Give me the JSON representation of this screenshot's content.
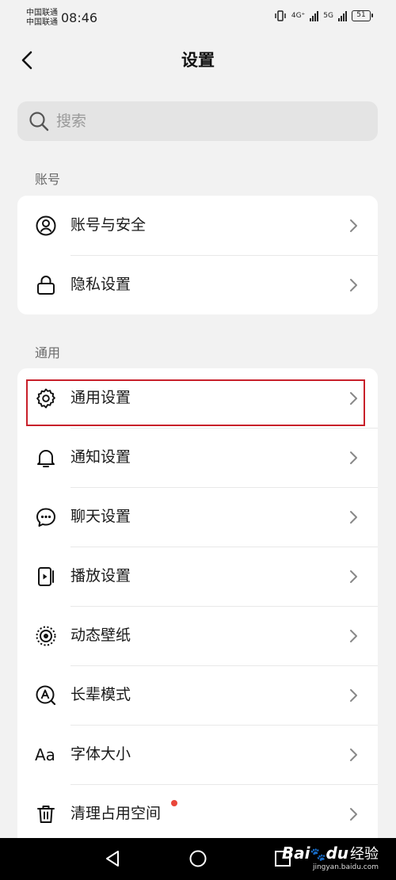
{
  "status_bar": {
    "carrier_1": "中国联通",
    "carrier_2": "中国联通",
    "time": "08:46",
    "network_1": "4G⁺",
    "network_2": "5G",
    "battery": "51"
  },
  "header": {
    "title": "设置",
    "back_icon": "chevron-left-icon"
  },
  "search": {
    "placeholder": "搜索",
    "value": "",
    "icon": "search-icon"
  },
  "sections": [
    {
      "label": "账号",
      "items": [
        {
          "label": "账号与安全",
          "icon": "user-circle-icon"
        },
        {
          "label": "隐私设置",
          "icon": "lock-icon"
        }
      ]
    },
    {
      "label": "通用",
      "items": [
        {
          "label": "通用设置",
          "icon": "gear-icon"
        },
        {
          "label": "通知设置",
          "icon": "bell-icon"
        },
        {
          "label": "聊天设置",
          "icon": "chat-bubble-icon"
        },
        {
          "label": "播放设置",
          "icon": "play-device-icon"
        },
        {
          "label": "动态壁纸",
          "icon": "live-wallpaper-icon"
        },
        {
          "label": "长辈模式",
          "icon": "elder-mode-icon"
        },
        {
          "label": "字体大小",
          "icon": "font-size-icon",
          "glyph": "Aa"
        },
        {
          "label": "清理占用空间",
          "icon": "trash-icon",
          "badge": "red-dot"
        }
      ]
    }
  ],
  "system_nav": {
    "icons": [
      "back-triangle-icon",
      "home-circle-icon",
      "recents-square-icon"
    ]
  },
  "watermark": {
    "brand": "Bai",
    "brand_suffix": "du",
    "cn": "经验",
    "url": "jingyan.baidu.com"
  },
  "colors": {
    "background": "#f2f2f2",
    "card": "#ffffff",
    "highlight": "#c8202a",
    "badge": "#e9463a"
  }
}
